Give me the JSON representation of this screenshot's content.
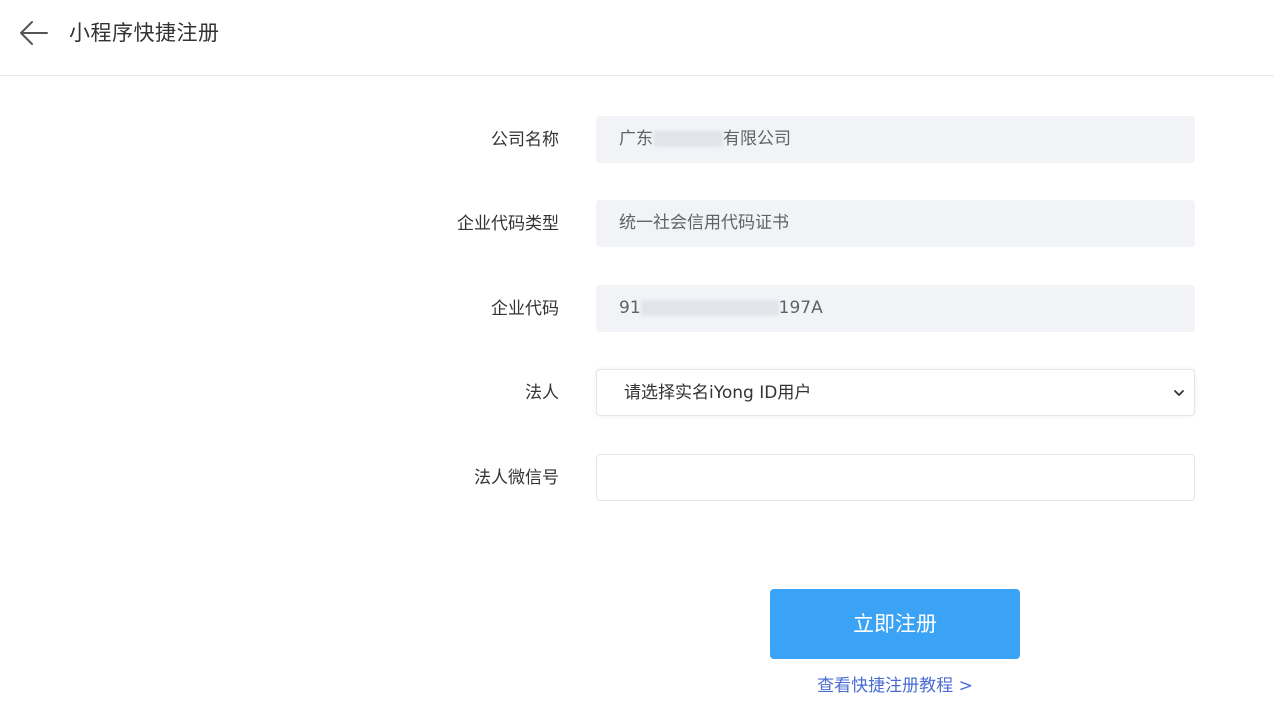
{
  "header": {
    "back_icon": "arrow-left-icon",
    "title": "小程序快捷注册"
  },
  "form": {
    "company_name": {
      "label": "公司名称",
      "value_prefix": "广东",
      "value_suffix": "有限公司"
    },
    "code_type": {
      "label": "企业代码类型",
      "value": "统一社会信用代码证书"
    },
    "enterprise_code": {
      "label": "企业代码",
      "value_prefix": "91",
      "value_suffix": "197A"
    },
    "legal_person": {
      "label": "法人",
      "selected": "请选择实名iYong ID用户",
      "icon": "chevron-down-icon"
    },
    "legal_wechat": {
      "label": "法人微信号",
      "value": ""
    }
  },
  "actions": {
    "submit_label": "立即注册",
    "tutorial_link": "查看快捷注册教程 >"
  },
  "colors": {
    "primary": "#3aa3f5",
    "link": "#4a6cd3",
    "readonly_bg": "#f2f3f7"
  }
}
